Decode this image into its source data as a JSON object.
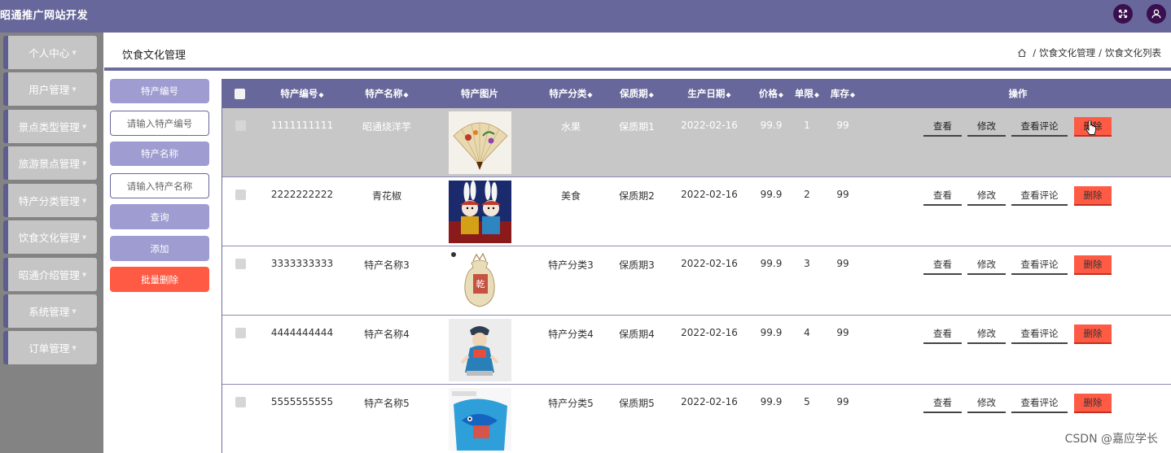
{
  "app": {
    "title": "昭通推广网站开发"
  },
  "top_icons": [
    "expand-icon",
    "user-icon"
  ],
  "sidebar": {
    "items": [
      {
        "label": "个人中心"
      },
      {
        "label": "用户管理"
      },
      {
        "label": "景点类型管理"
      },
      {
        "label": "旅游景点管理"
      },
      {
        "label": "特产分类管理"
      },
      {
        "label": "饮食文化管理"
      },
      {
        "label": "昭通介绍管理"
      },
      {
        "label": "系统管理"
      },
      {
        "label": "订单管理"
      }
    ]
  },
  "header": {
    "title": "饮食文化管理",
    "breadcrumb": [
      "饮食文化管理",
      "饮食文化列表"
    ]
  },
  "filter": {
    "code_label": "特产编号",
    "code_placeholder": "请输入特产编号",
    "name_label": "特产名称",
    "name_placeholder": "请输入特产名称",
    "search_button": "查询",
    "add_button": "添加",
    "batch_delete_button": "批量删除"
  },
  "table": {
    "columns": [
      "特产编号",
      "特产名称",
      "特产图片",
      "特产分类",
      "保质期",
      "生产日期",
      "价格",
      "单限",
      "库存",
      "操作"
    ],
    "rows": [
      {
        "code": "1111111111",
        "name": "昭通烧洋芋",
        "category": "水果",
        "shelf": "保质期1",
        "date": "2022-02-16",
        "price": "99.9",
        "limit": "1",
        "stock": "99",
        "image": "fan"
      },
      {
        "code": "2222222222",
        "name": "青花椒",
        "category": "美食",
        "shelf": "保质期2",
        "date": "2022-02-16",
        "price": "99.9",
        "limit": "2",
        "stock": "99",
        "image": "rabbits"
      },
      {
        "code": "3333333333",
        "name": "特产名称3",
        "category": "特产分类3",
        "shelf": "保质期3",
        "date": "2022-02-16",
        "price": "99.9",
        "limit": "3",
        "stock": "99",
        "image": "sack"
      },
      {
        "code": "4444444444",
        "name": "特产名称4",
        "category": "特产分类4",
        "shelf": "保质期4",
        "date": "2022-02-16",
        "price": "99.9",
        "limit": "4",
        "stock": "99",
        "image": "figurine"
      },
      {
        "code": "5555555555",
        "name": "特产名称5",
        "category": "特产分类5",
        "shelf": "保质期5",
        "date": "2022-02-16",
        "price": "99.9",
        "limit": "5",
        "stock": "99",
        "image": "fish-bag"
      }
    ],
    "actions": {
      "view": "查看",
      "edit": "修改",
      "comments": "查看评论",
      "delete": "删除"
    }
  },
  "watermark": "CSDN @嘉应学长",
  "colors": {
    "primary": "#67679b",
    "danger": "#ff5a44",
    "sidebar": "#838383"
  }
}
